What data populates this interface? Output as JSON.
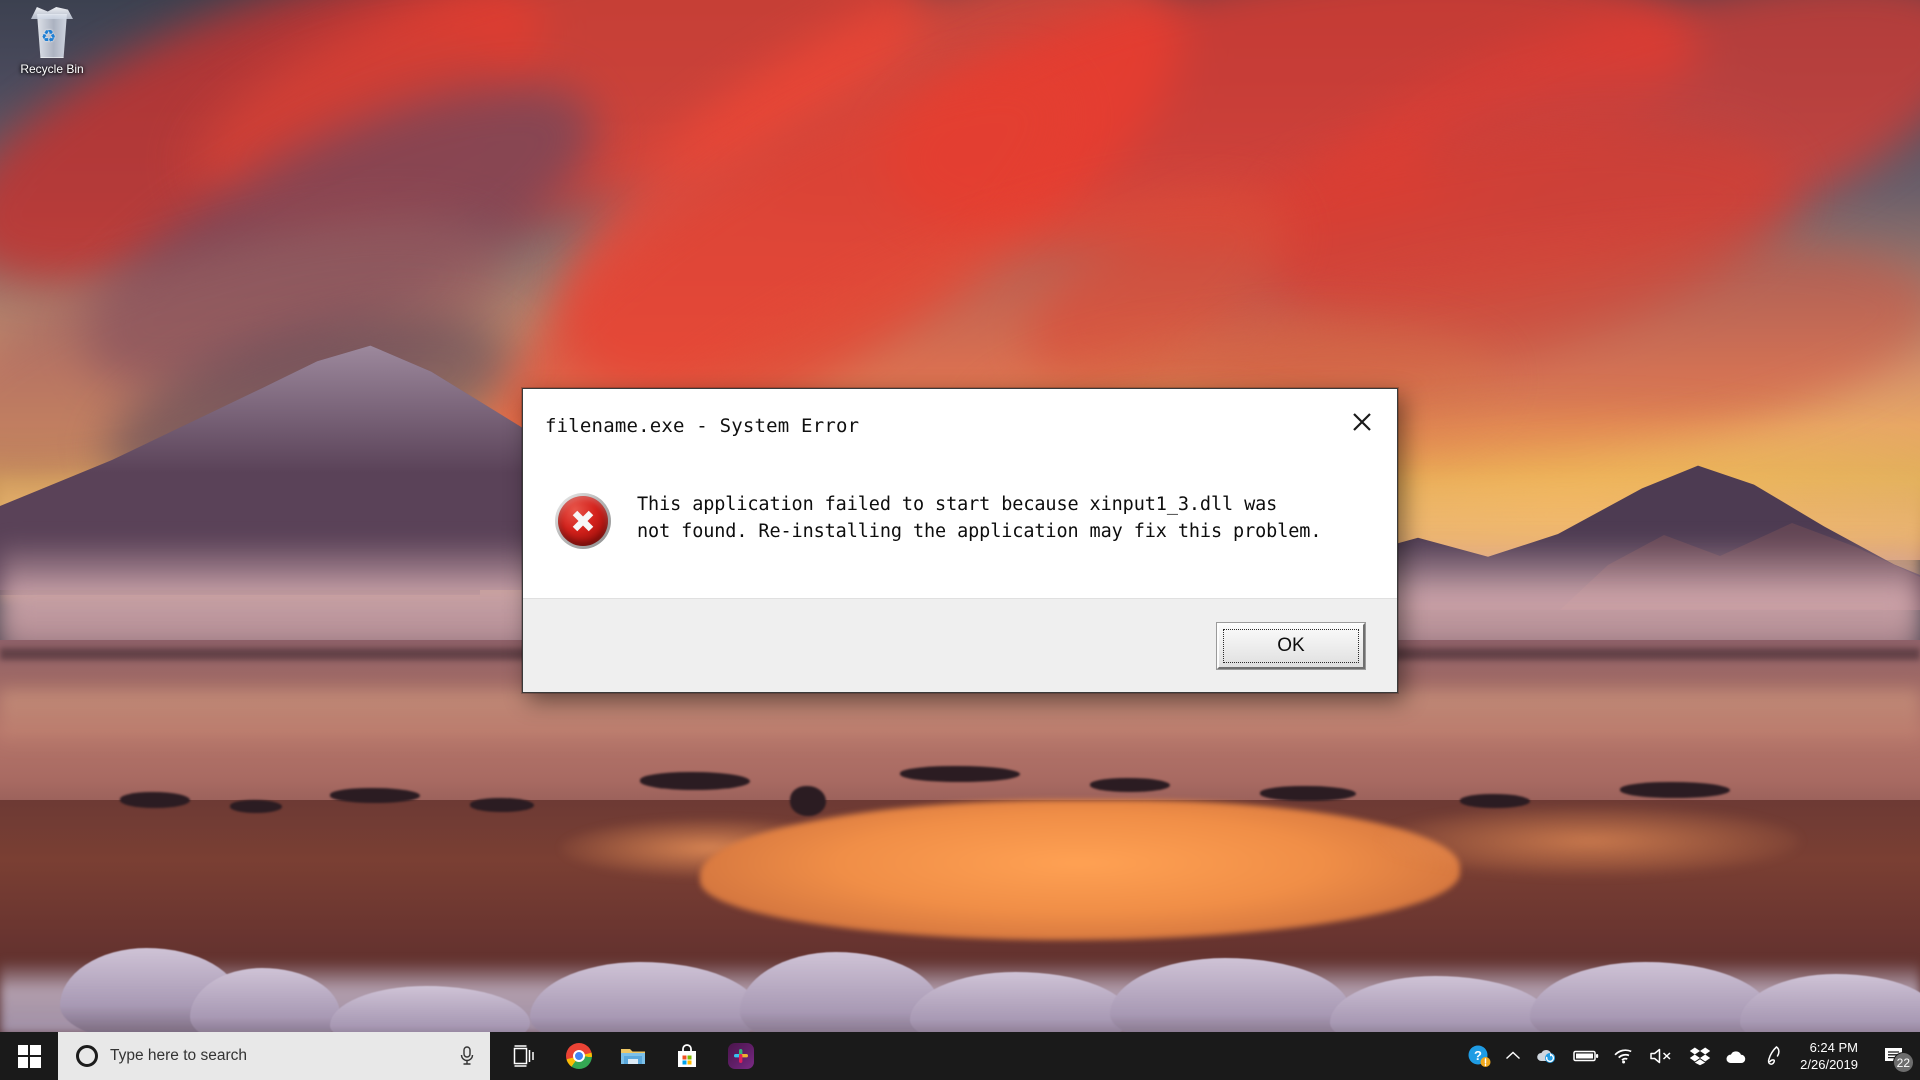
{
  "desktop": {
    "icons": [
      {
        "label": "Recycle Bin",
        "icon": "recycle-bin-icon"
      }
    ],
    "wallpaper": {
      "description": "Sunset over snow-covered lake with red clouds and mountains",
      "sky_top_color": "#3c4150",
      "cloud_color": "#e83e30",
      "glow_color": "#f5c05a",
      "water_color": "#b5756a",
      "pool_color": "#ffa153"
    }
  },
  "dialog": {
    "title": "filename.exe - System Error",
    "close_label": "✕",
    "icon": "error-icon",
    "message": "This application failed to start because xinput1_3.dll was\nnot found. Re-installing the application may fix this problem.",
    "message_line1": "This application failed to start because xinput1_3.dll was",
    "message_line2": "not found. Re-installing the application may fix this problem.",
    "buttons": [
      {
        "label": "OK",
        "name": "ok-button",
        "default": true
      }
    ],
    "error_icon_color": "#d4221c",
    "footer_color": "#efefef"
  },
  "taskbar": {
    "background": "#1a1a1a",
    "start": {
      "label": "Start",
      "icon": "windows-logo-icon"
    },
    "search": {
      "placeholder": "Type here to search",
      "cortana_icon": "cortana-circle-icon",
      "mic_icon": "microphone-icon",
      "background": "#e8e8e8"
    },
    "pinned": [
      {
        "name": "task-view",
        "label": "Task View",
        "icon": "task-view-icon"
      },
      {
        "name": "chrome",
        "label": "Google Chrome",
        "icon": "chrome-icon"
      },
      {
        "name": "file-explorer",
        "label": "File Explorer",
        "icon": "folder-icon"
      },
      {
        "name": "microsoft-store",
        "label": "Microsoft Store",
        "icon": "store-bag-icon"
      },
      {
        "name": "slack",
        "label": "Slack",
        "icon": "slack-icon"
      }
    ],
    "tray": [
      {
        "name": "help-alert",
        "icon": "question-circle-icon"
      },
      {
        "name": "show-hidden-icons",
        "icon": "chevron-up-icon"
      },
      {
        "name": "onedrive-sync",
        "icon": "cloud-sync-icon"
      },
      {
        "name": "battery",
        "icon": "battery-icon"
      },
      {
        "name": "network",
        "icon": "wifi-icon"
      },
      {
        "name": "volume-muted",
        "icon": "speaker-mute-icon"
      },
      {
        "name": "dropbox",
        "icon": "dropbox-icon"
      },
      {
        "name": "onedrive",
        "icon": "cloud-icon"
      },
      {
        "name": "pen-workspace",
        "icon": "pen-icon"
      }
    ],
    "clock": {
      "time": "6:24 PM",
      "date": "2/26/2019"
    },
    "notifications": {
      "count": "22",
      "icon": "action-center-icon"
    }
  }
}
